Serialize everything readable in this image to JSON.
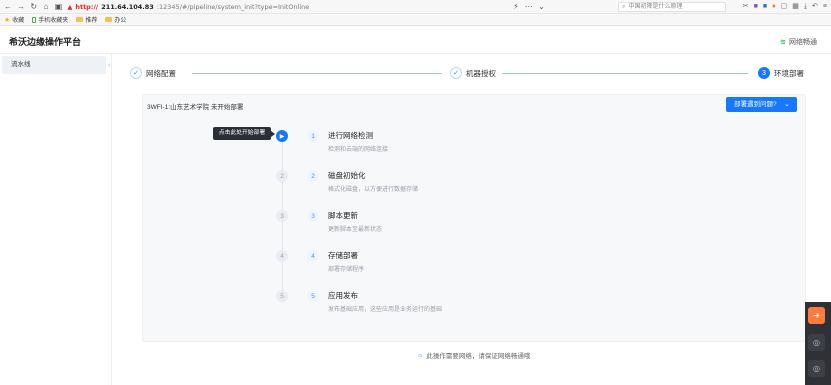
{
  "browser": {
    "url_scheme": "http://",
    "url_host": "211.64.104.83",
    "url_path": ":12345/#/pipeline/system_init?type=InitOnline",
    "search_placeholder": "中国初降是什么原理",
    "bookmarks": [
      {
        "label": "收藏"
      },
      {
        "label": "手机收藏夹"
      },
      {
        "label": "推荐"
      },
      {
        "label": "办公"
      }
    ]
  },
  "app": {
    "title": "希沃边缘操作平台",
    "network_status": "网络畅通"
  },
  "sidebar": {
    "items": [
      {
        "label": "流水线"
      }
    ]
  },
  "steps": [
    {
      "index": "✓",
      "label": "网络配置",
      "state": "done"
    },
    {
      "index": "✓",
      "label": "机器授权",
      "state": "done"
    },
    {
      "index": "3",
      "label": "环境部署",
      "state": "active"
    }
  ],
  "panel": {
    "title": "3WFI-1:山东艺术学院 未开始部署",
    "issue_button": "部署遇到问题?",
    "tooltip": "点击此处开始部署",
    "tasks": [
      {
        "left_index": "▶",
        "right_index": "1",
        "title": "进行网络检测",
        "desc": "检测和云端的网络连接"
      },
      {
        "left_index": "2",
        "right_index": "2",
        "title": "磁盘初始化",
        "desc": "格式化磁盘，以方便进行数据存储"
      },
      {
        "left_index": "3",
        "right_index": "3",
        "title": "脚本更新",
        "desc": "更新脚本至最新状态"
      },
      {
        "left_index": "4",
        "right_index": "4",
        "title": "存储部署",
        "desc": "部署存储程序"
      },
      {
        "left_index": "5",
        "right_index": "5",
        "title": "应用发布",
        "desc": "发布基础应用，这些应用是业务运行的基础"
      }
    ]
  },
  "notice": "此操作需要网络，请保证网络畅通哦",
  "colors": {
    "primary": "#1677ff",
    "success": "#3bb54a"
  }
}
